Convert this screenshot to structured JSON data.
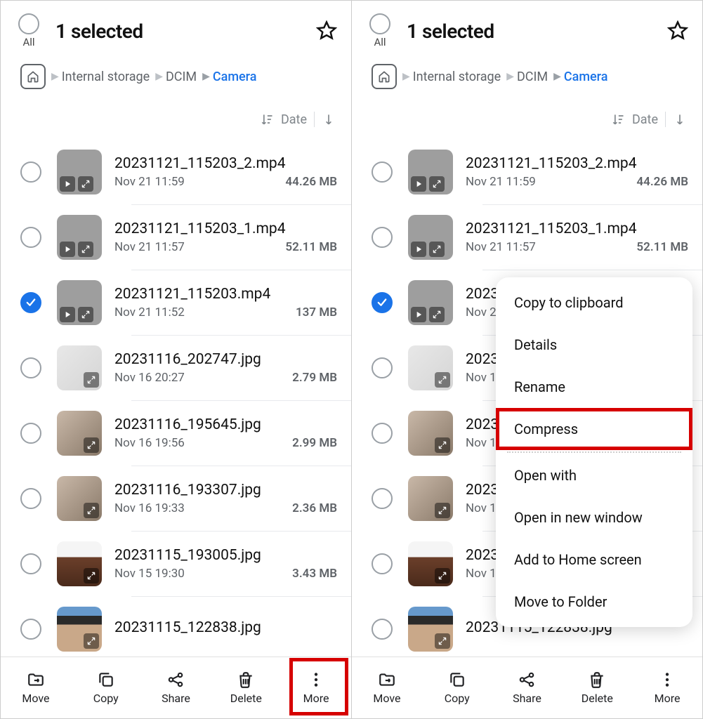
{
  "header": {
    "all_label": "All",
    "title": "1 selected"
  },
  "breadcrumb": {
    "items": [
      "Internal storage",
      "DCIM",
      "Camera"
    ]
  },
  "sort": {
    "label": "Date"
  },
  "files": [
    {
      "name": "20231121_115203_2.mp4",
      "date": "Nov 21 11:59",
      "size": "44.26 MB",
      "thumb": "grey",
      "video": true,
      "selected": false
    },
    {
      "name": "20231121_115203_1.mp4",
      "date": "Nov 21 11:57",
      "size": "52.11 MB",
      "thumb": "grey",
      "video": true,
      "selected": false
    },
    {
      "name": "20231121_115203.mp4",
      "date": "Nov 21 11:52",
      "size": "137 MB",
      "thumb": "grey",
      "video": true,
      "selected": true
    },
    {
      "name": "20231116_202747.jpg",
      "date": "Nov 16 20:27",
      "size": "2.79 MB",
      "thumb": "paper",
      "video": false,
      "selected": false
    },
    {
      "name": "20231116_195645.jpg",
      "date": "Nov 16 19:56",
      "size": "2.99 MB",
      "thumb": "desk",
      "video": false,
      "selected": false
    },
    {
      "name": "20231116_193307.jpg",
      "date": "Nov 16 19:33",
      "size": "2.36 MB",
      "thumb": "desk",
      "video": false,
      "selected": false
    },
    {
      "name": "20231115_193005.jpg",
      "date": "Nov 15 19:30",
      "size": "3.43 MB",
      "thumb": "wood",
      "video": false,
      "selected": false
    },
    {
      "name": "20231115_122838.jpg",
      "date": "",
      "size": "",
      "thumb": "skin",
      "video": false,
      "selected": false
    }
  ],
  "bottom": {
    "move": "Move",
    "copy": "Copy",
    "share": "Share",
    "delete": "Delete",
    "more": "More"
  },
  "menu": {
    "items": [
      "Copy to clipboard",
      "Details",
      "Rename",
      "Compress",
      "Open with",
      "Open in new window",
      "Add to Home screen",
      "Move to Folder"
    ],
    "highlight": "Compress",
    "separator_after": "Compress"
  }
}
